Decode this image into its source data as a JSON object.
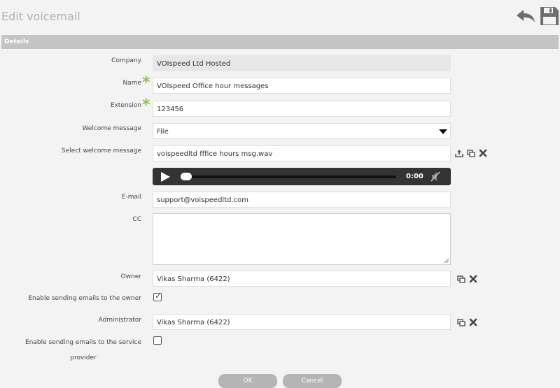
{
  "page": {
    "title": "Edit voicemail"
  },
  "section": {
    "title": "Details"
  },
  "form": {
    "company": {
      "label": "Company",
      "value": "VOIspeed Ltd Hosted"
    },
    "name": {
      "label": "Name",
      "value": "VOIspeed Office hour messages"
    },
    "extension": {
      "label": "Extension",
      "value": "123456"
    },
    "welcome_message": {
      "label": "Welcome message",
      "value": "File"
    },
    "select_welcome_message": {
      "label": "Select welcome message",
      "value": "voispeedltd fffice hours msg.wav"
    },
    "player": {
      "time": "0:00"
    },
    "email": {
      "label": "E-mail",
      "value": "support@voispeedltd.com"
    },
    "cc": {
      "label": "CC",
      "value": ""
    },
    "owner": {
      "label": "Owner",
      "value": "Vikas Sharma (6422)"
    },
    "enable_owner_emails": {
      "label": "Enable sending emails to the owner",
      "checked": true
    },
    "administrator": {
      "label": "Administrator",
      "value": "Vikas Sharma (6422)"
    },
    "enable_provider_emails": {
      "label": "Enable sending emails to the service provider",
      "checked": false
    }
  },
  "buttons": {
    "ok": "OK",
    "cancel": "Cancel"
  },
  "icons": {
    "back": "undo-arrow-icon",
    "save": "floppy-disk-icon",
    "upload": "upload-icon",
    "copy": "copy-icon",
    "clear": "close-x-icon",
    "play": "play-icon",
    "mute": "volume-muted-icon"
  },
  "colors": {
    "required": "#8cc63f",
    "header": "#c4c4c4",
    "button": "#b5b5b5"
  }
}
